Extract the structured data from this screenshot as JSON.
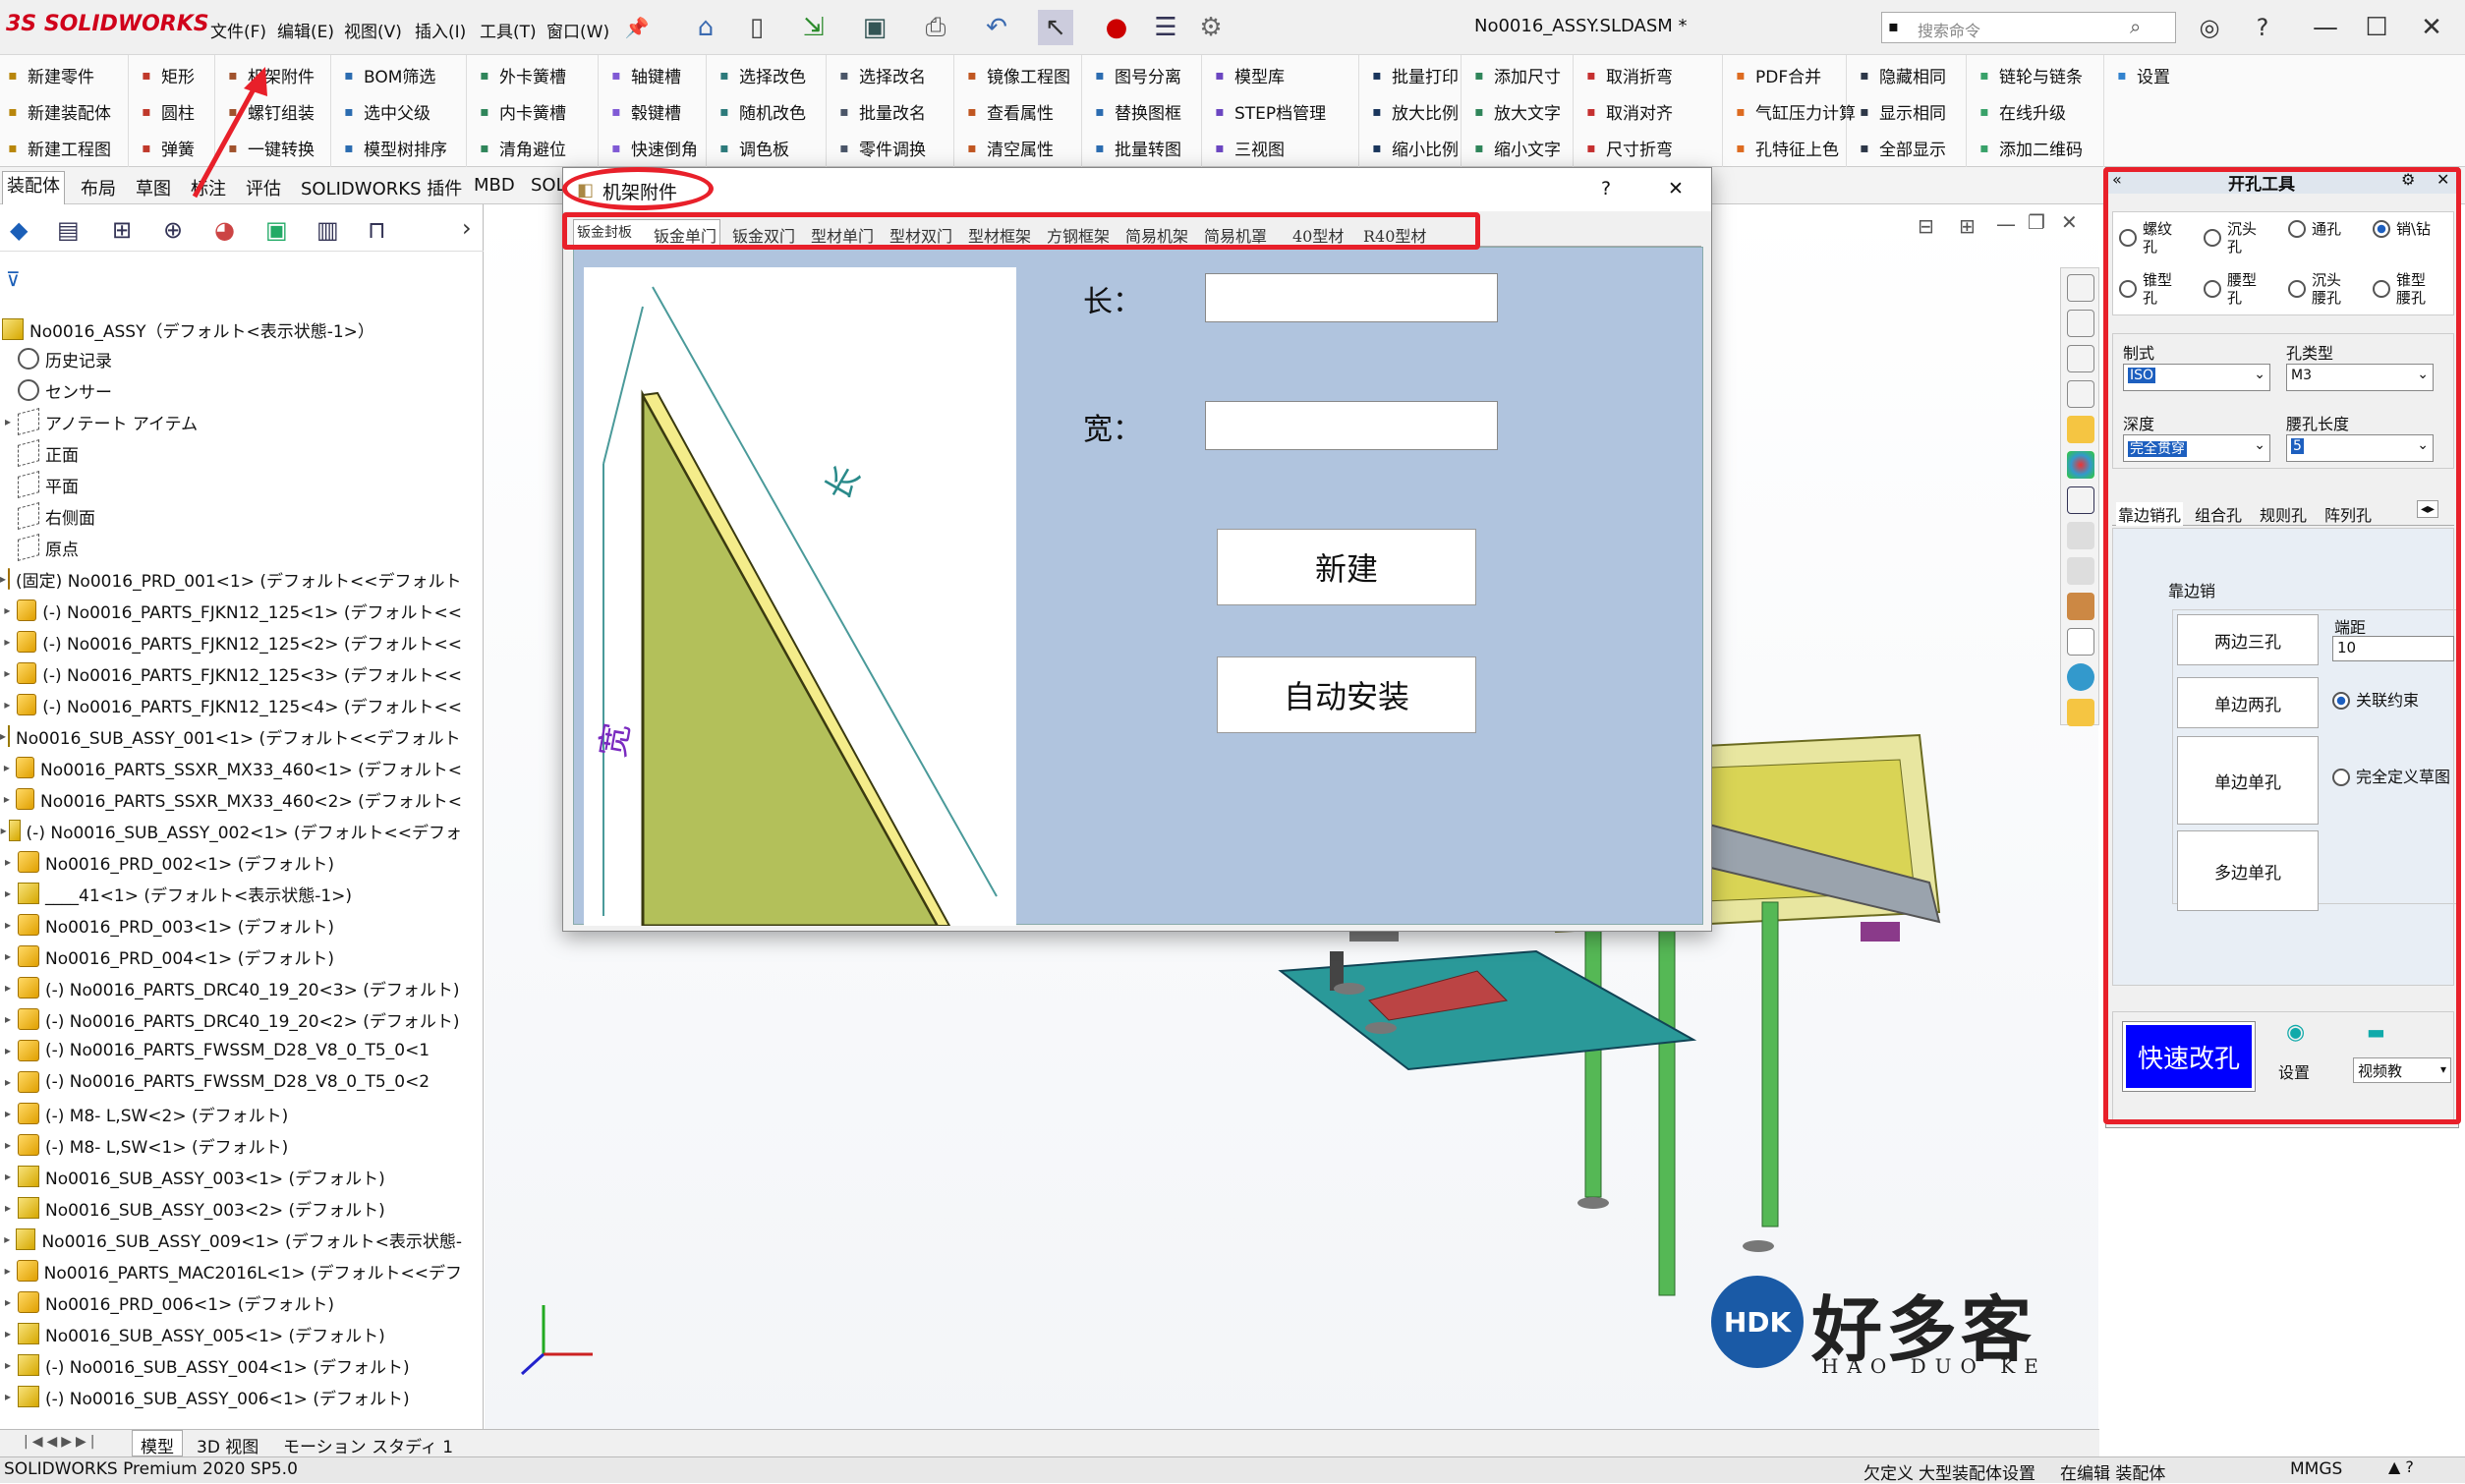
{
  "app": {
    "name": "SOLIDWORKS",
    "document_title": "No0016_ASSY.SLDASM *",
    "search_placeholder": "搜索命令"
  },
  "menu": [
    "文件(F)",
    "编辑(E)",
    "视图(V)",
    "插入(I)",
    "工具(T)",
    "窗口(W)"
  ],
  "toolbar": {
    "col1": [
      "新建零件",
      "新建装配体",
      "新建工程图"
    ],
    "col2": [
      "矩形",
      "圆柱",
      "弹簧"
    ],
    "col3": [
      "机架附件",
      "螺钉组装",
      "一键转换"
    ],
    "col4": [
      "BOM筛选",
      "选中父级",
      "模型树排序"
    ],
    "col5": [
      "外卡簧槽",
      "内卡簧槽",
      "清角避位"
    ],
    "col6": [
      "轴键槽",
      "毂键槽",
      "快速倒角"
    ],
    "col7": [
      "选择改色",
      "随机改色",
      "调色板"
    ],
    "col8": [
      "选择改名",
      "批量改名",
      "零件调换"
    ],
    "col9": [
      "镜像工程图",
      "查看属性",
      "清空属性"
    ],
    "col10": [
      "图号分离",
      "替换图框",
      "批量转图"
    ],
    "col11": [
      "模型库",
      "STEP档管理",
      "三视图"
    ],
    "col12": [
      "批量打印",
      "放大比例",
      "缩小比例"
    ],
    "col13": [
      "添加尺寸",
      "放大文字",
      "缩小文字"
    ],
    "col14": [
      "取消折弯",
      "取消对齐",
      "尺寸折弯"
    ],
    "col15": [
      "PDF合并",
      "气缸压力计算",
      "孔特征上色"
    ],
    "col16": [
      "隐藏相同",
      "显示相同",
      "全部显示"
    ],
    "col17": [
      "链轮与链条",
      "在线升级",
      "添加二维码"
    ],
    "col18": [
      "设置"
    ]
  },
  "command_tabs": [
    "装配体",
    "布局",
    "草图",
    "标注",
    "评估",
    "SOLIDWORKS 插件",
    "MBD",
    "SOL"
  ],
  "tree": {
    "root": "No0016_ASSY（デフォルト<表示状態-1>）",
    "items": [
      "历史记录",
      "センサー",
      "アノテート アイテム",
      "正面",
      "平面",
      "右侧面",
      "原点",
      "(固定) No0016_PRD_001<1> (デフォルト<<デフォルト>",
      "(-) No0016_PARTS_FJKN12_125<1> (デフォルト<<",
      "(-) No0016_PARTS_FJKN12_125<2> (デフォルト<<",
      "(-) No0016_PARTS_FJKN12_125<3> (デフォルト<<",
      "(-) No0016_PARTS_FJKN12_125<4> (デフォルト<<",
      "No0016_SUB_ASSY_001<1> (デフォルト<<デフォルト>",
      "No0016_PARTS_SSXR_MX33_460<1> (デフォルト<",
      "No0016_PARTS_SSXR_MX33_460<2> (デフォルト<",
      "(-) No0016_SUB_ASSY_002<1> (デフォルト<<デフォ",
      "No0016_PRD_002<1> (デフォルト)",
      "____41<1> (デフォルト<表示状態-1>)",
      "No0016_PRD_003<1> (デフォルト)",
      "No0016_PRD_004<1> (デフォルト)",
      "(-) No0016_PARTS_DRC40_19_20<3> (デフォルト)",
      "(-) No0016_PARTS_DRC40_19_20<2> (デフォルト)",
      "(-) No0016_PARTS_FWSSM_D28_V8_0_T5_0<1",
      "(-) No0016_PARTS_FWSSM_D28_V8_0_T5_0<2",
      "(-) M8-  L,SW<2> (デフォルト)",
      "(-) M8-  L,SW<1> (デフォルト)",
      "No0016_SUB_ASSY_003<1> (デフォルト)",
      "No0016_SUB_ASSY_003<2> (デフォルト)",
      "No0016_SUB_ASSY_009<1> (デフォルト<表示状態-",
      "No0016_PARTS_MAC2016L<1> (デフォルト<<デフ",
      "No0016_PRD_006<1> (デフォルト)",
      "No0016_SUB_ASSY_005<1> (デフォルト)",
      "(-) No0016_SUB_ASSY_004<1> (デフォルト)",
      "(-) No0016_SUB_ASSY_006<1> (デフォルト)"
    ]
  },
  "dialog": {
    "title": "机架附件",
    "help": "?",
    "close": "✕",
    "tabs": [
      "钣金封板",
      "钣金单门",
      "钣金双门",
      "型材单门",
      "型材双门",
      "型材框架",
      "方钢框架",
      "简易机架",
      "简易机罩",
      "40型材",
      "R40型材"
    ],
    "selected_tab": "钣金封板",
    "length_label": "长：",
    "width_label": "宽：",
    "length_value": "",
    "width_value": "",
    "new_button": "新建",
    "auto_install_button": "自动安装",
    "diagram_label_long": "长",
    "diagram_label_wide": "宽"
  },
  "panel": {
    "title": "开孔工具",
    "hole_types": [
      "螺纹孔",
      "沉头孔",
      "通孔",
      "销\\钻",
      "锥型孔",
      "腰型孔",
      "沉头腰孔",
      "锥型腰孔"
    ],
    "selected_hole_type": "销\\钻",
    "standard_label": "制式",
    "standard_value": "ISO",
    "hole_class_label": "孔类型",
    "hole_class_value": "M3",
    "depth_label": "深度",
    "depth_value": "完全贯穿",
    "slot_length_label": "腰孔长度",
    "slot_length_value": "5",
    "tabs": [
      "靠边销孔",
      "组合孔",
      "规则孔",
      "阵列孔"
    ],
    "group_title": "靠边销",
    "buttons": [
      "两边三孔",
      "单边两孔",
      "单边单孔",
      "多边单孔"
    ],
    "end_distance_label": "端距",
    "end_distance_value": "10",
    "assoc_constraint": "关联约束",
    "full_define": "完全定义草图",
    "quick_change": "快速改孔",
    "settings": "设置",
    "video": "视频教"
  },
  "bottom_tabs": [
    "模型",
    "3D 视图",
    "モーション スタディ 1"
  ],
  "status": {
    "version": "SOLIDWORKS Premium 2020 SP5.0",
    "underdefined": "欠定义",
    "large_asm": "大型装配体设置",
    "editing": "在编辑 装配体",
    "units": "MMGS"
  },
  "watermark": {
    "brand": "好多客",
    "pinyin": "HAO DUO KE",
    "logo": "HDK"
  },
  "colors": {
    "accent_red": "#e8202a",
    "dialog_body": "#b0c4de",
    "panel_button": "#0000ff",
    "brand_blue": "#1a5aa6"
  }
}
